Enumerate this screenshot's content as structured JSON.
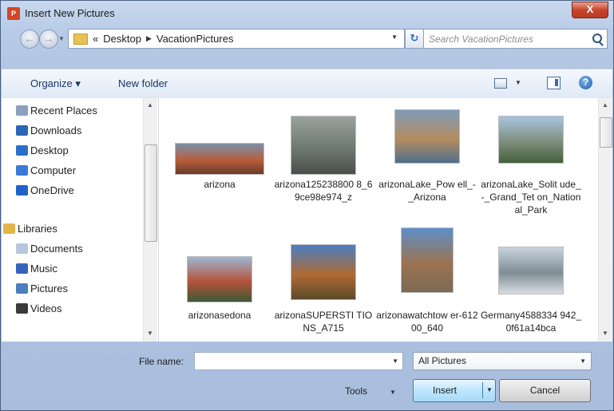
{
  "window": {
    "title": "Insert New Pictures",
    "app_icon": "powerpoint-icon",
    "close_glyph": "X"
  },
  "address": {
    "back_glyph": "←",
    "forward_glyph": "→",
    "prefix": "«",
    "crumbs": [
      "Desktop",
      "VacationPictures"
    ],
    "search_placeholder": "Search VacationPictures"
  },
  "toolbar": {
    "organize": "Organize ▾",
    "new_folder": "New folder"
  },
  "nav_pane": {
    "items": [
      {
        "label": "Recent Places",
        "icon": "recent-places-icon",
        "color": "#8aa0bd"
      },
      {
        "label": "Downloads",
        "icon": "downloads-icon",
        "color": "#2b66b7"
      },
      {
        "label": "Desktop",
        "icon": "desktop-icon",
        "color": "#2a6fc9"
      },
      {
        "label": "Computer",
        "icon": "computer-icon",
        "color": "#3a7bd5"
      },
      {
        "label": "OneDrive",
        "icon": "onedrive-icon",
        "color": "#1f63c6"
      },
      {
        "label": "Libraries",
        "icon": "libraries-icon",
        "color": "#e2b54a"
      },
      {
        "label": "Documents",
        "icon": "documents-icon",
        "color": "#b7c6d9"
      },
      {
        "label": "Music",
        "icon": "music-icon",
        "color": "#3563b9"
      },
      {
        "label": "Pictures",
        "icon": "pictures-icon",
        "color": "#4b7fbf"
      },
      {
        "label": "Videos",
        "icon": "videos-icon",
        "color": "#3a3a3a"
      }
    ]
  },
  "files": [
    {
      "name": "arizona",
      "colors": [
        "#7b8fa8",
        "#b85d3c",
        "#6a3b2a"
      ]
    },
    {
      "name": "arizona125238800 8_69ce98e974_z",
      "colors": [
        "#9aa29d",
        "#6d7a70",
        "#4a4f4a"
      ]
    },
    {
      "name": "arizonaLake_Pow ell_-_Arizona",
      "colors": [
        "#7f9bb8",
        "#b48c5e",
        "#4f6f8c"
      ]
    },
    {
      "name": "arizonaLake_Solit ude_-_Grand_Tet on_National_Park",
      "colors": [
        "#a9c3e0",
        "#7e8e7c",
        "#44603d"
      ]
    },
    {
      "name": "arizonasedona",
      "colors": [
        "#9eb7d3",
        "#b5523a",
        "#3d5a36"
      ]
    },
    {
      "name": "arizonaSUPERSTI TIONS_A715",
      "colors": [
        "#4a7fc4",
        "#b06a33",
        "#5a4a2a"
      ]
    },
    {
      "name": "arizonawatchtow er-61200_640",
      "colors": [
        "#5d8fc8",
        "#9c7351",
        "#7b6a55"
      ]
    },
    {
      "name": "Germany4588334 942_0f61a14bca",
      "colors": [
        "#c8d3de",
        "#7f8d95",
        "#d9dde2"
      ]
    }
  ],
  "bottom": {
    "file_name_label": "File name:",
    "file_name_value": "",
    "filter": "All Pictures",
    "tools": "Tools",
    "insert": "Insert",
    "cancel": "Cancel"
  }
}
